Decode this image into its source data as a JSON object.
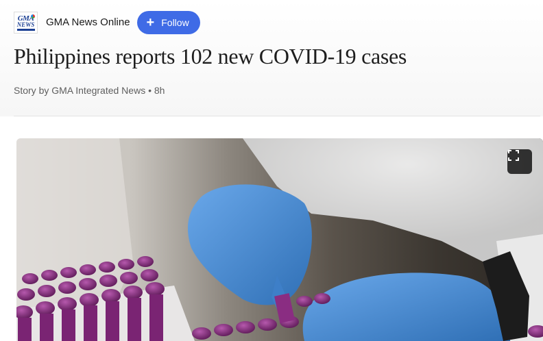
{
  "source": {
    "name": "GMA News Online",
    "logo_text_top": "GMA",
    "logo_text_bottom": "NEWS",
    "follow_label": "Follow",
    "follow_icon": "plus-icon"
  },
  "article": {
    "headline": "Philippines reports 102 new COVID-19 cases",
    "byline": "Story by GMA Integrated News • 8h"
  },
  "image": {
    "expand_icon": "expand-icon"
  },
  "colors": {
    "follow_button": "#3f6be6",
    "headline": "#1d1d1d",
    "byline": "#5e5e5e",
    "glove_blue": "#4a8fd8",
    "vial_purple": "#8a2d82"
  }
}
